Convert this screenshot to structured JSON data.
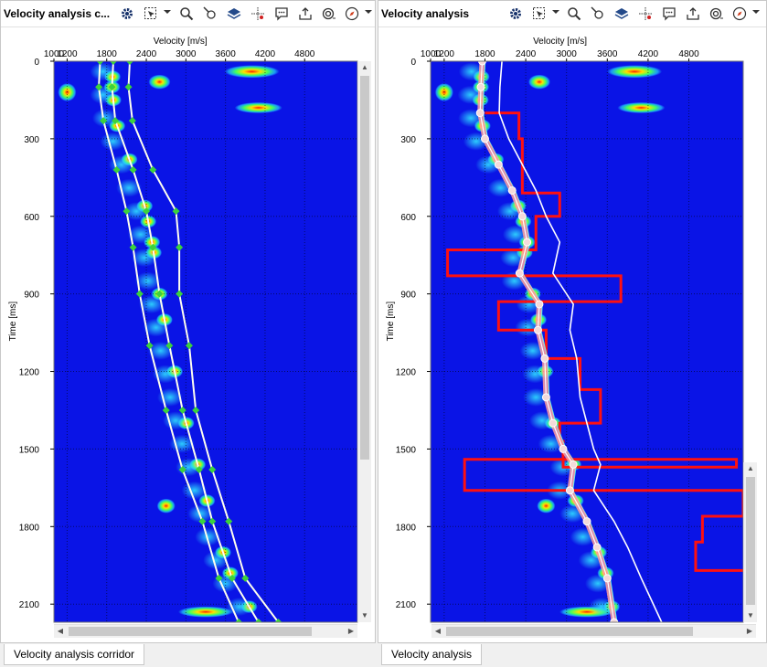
{
  "panels": [
    {
      "title": "Velocity analysis c...",
      "tab_label": "Velocity analysis corridor",
      "x_axis_label": "Velocity [m/s]",
      "y_axis_label": "Time [ms]",
      "x_ticks": [
        "1000",
        "1200",
        "1800",
        "2400",
        "3000",
        "3600",
        "4200",
        "4800"
      ],
      "y_ticks": [
        "0",
        "300",
        "600",
        "900",
        "1200",
        "1500",
        "1800",
        "2100"
      ]
    },
    {
      "title": "Velocity analysis",
      "tab_label": "Velocity analysis",
      "x_axis_label": "Velocity [m/s]",
      "y_axis_label": "Time [ms]",
      "x_ticks": [
        "1000",
        "1200",
        "1800",
        "2400",
        "3000",
        "3600",
        "4200",
        "4800"
      ],
      "y_ticks": [
        "0",
        "300",
        "600",
        "900",
        "1200",
        "1500",
        "1800",
        "2100"
      ]
    }
  ],
  "toolbar_icons": [
    "gear-icon",
    "select-icon",
    "zoom-icon",
    "pointer-icon",
    "layers-icon",
    "crosshair-icon",
    "comment-icon",
    "export-icon",
    "snapshot-icon",
    "compass-icon"
  ],
  "colors": {
    "semblance_background": "#0a14e6",
    "corridor_lines": "#ffffee",
    "corridor_points": "#3cd23c",
    "picked_function": "#ff9fa0",
    "interval_velocity": "#ff1010",
    "guide_function": "#40ffff"
  },
  "chart_data": [
    {
      "type": "heatmap",
      "title": "",
      "xlabel": "Velocity [m/s]",
      "ylabel": "Time [ms]",
      "xlim": [
        1000,
        5600
      ],
      "ylim": [
        2170,
        0
      ],
      "grid": true,
      "series": [
        {
          "x": [
            1700,
            1680,
            1750,
            1950,
            2100,
            2200,
            2300,
            2450,
            2700,
            2950,
            3250,
            3500,
            3800
          ],
          "y": [
            0,
            100,
            230,
            420,
            580,
            720,
            900,
            1100,
            1350,
            1580,
            1780,
            2000,
            2170
          ]
        },
        {
          "x": [
            1900,
            1880,
            1930,
            2200,
            2400,
            2500,
            2600,
            2750,
            2950,
            3200,
            3400,
            3700,
            4100
          ],
          "y": [
            0,
            100,
            230,
            420,
            580,
            720,
            900,
            1100,
            1350,
            1580,
            1780,
            2000,
            2170
          ]
        },
        {
          "x": [
            2150,
            2130,
            2190,
            2500,
            2850,
            2900,
            2900,
            3050,
            3150,
            3400,
            3650,
            3900,
            4400
          ],
          "y": [
            0,
            100,
            230,
            420,
            580,
            720,
            900,
            1100,
            1350,
            1580,
            1780,
            2000,
            2170
          ]
        }
      ]
    },
    {
      "type": "heatmap",
      "title": "",
      "xlabel": "Velocity [m/s]",
      "ylabel": "Time [ms]",
      "xlim": [
        1000,
        5600
      ],
      "ylim": [
        2170,
        0
      ],
      "grid": true,
      "series": [
        {
          "x": [
            1760,
            1740,
            1730,
            1800,
            2000,
            2200,
            2350,
            2420,
            2310,
            2600,
            2580,
            2680,
            2700,
            2800,
            2950,
            3100,
            3050,
            3300,
            3450,
            3600,
            3700
          ],
          "y": [
            0,
            100,
            200,
            300,
            400,
            500,
            600,
            700,
            820,
            940,
            1040,
            1150,
            1300,
            1400,
            1500,
            1560,
            1660,
            1780,
            1880,
            2000,
            2170
          ]
        },
        {
          "x": [
            2050,
            2020,
            2010,
            2150,
            2350,
            2550,
            2700,
            2900,
            2800,
            3100,
            3050,
            3150,
            3200,
            3300,
            3400,
            3500,
            3400,
            3700,
            3900,
            4100,
            4400
          ],
          "y": [
            0,
            100,
            200,
            300,
            400,
            500,
            600,
            700,
            820,
            940,
            1040,
            1150,
            1300,
            1400,
            1500,
            1560,
            1660,
            1780,
            1880,
            2000,
            2170
          ]
        },
        {
          "x": [
            1800,
            2300,
            2300,
            2350,
            2350,
            2900,
            2900,
            2550,
            2550,
            1250,
            1250,
            3800,
            3800,
            2000,
            2000,
            2700,
            2700,
            3200,
            3200,
            3500,
            3500,
            2900,
            2900,
            2950,
            2950,
            5500,
            5500,
            1500,
            1500,
            5600,
            5600,
            5000,
            5000,
            4900,
            4900,
            5600
          ],
          "y": [
            200,
            200,
            300,
            300,
            510,
            510,
            600,
            600,
            730,
            730,
            830,
            830,
            930,
            930,
            1040,
            1040,
            1150,
            1150,
            1270,
            1270,
            1400,
            1400,
            1470,
            1470,
            1570,
            1570,
            1540,
            1540,
            1660,
            1660,
            1760,
            1760,
            1860,
            1860,
            1970,
            1970
          ]
        }
      ]
    }
  ]
}
